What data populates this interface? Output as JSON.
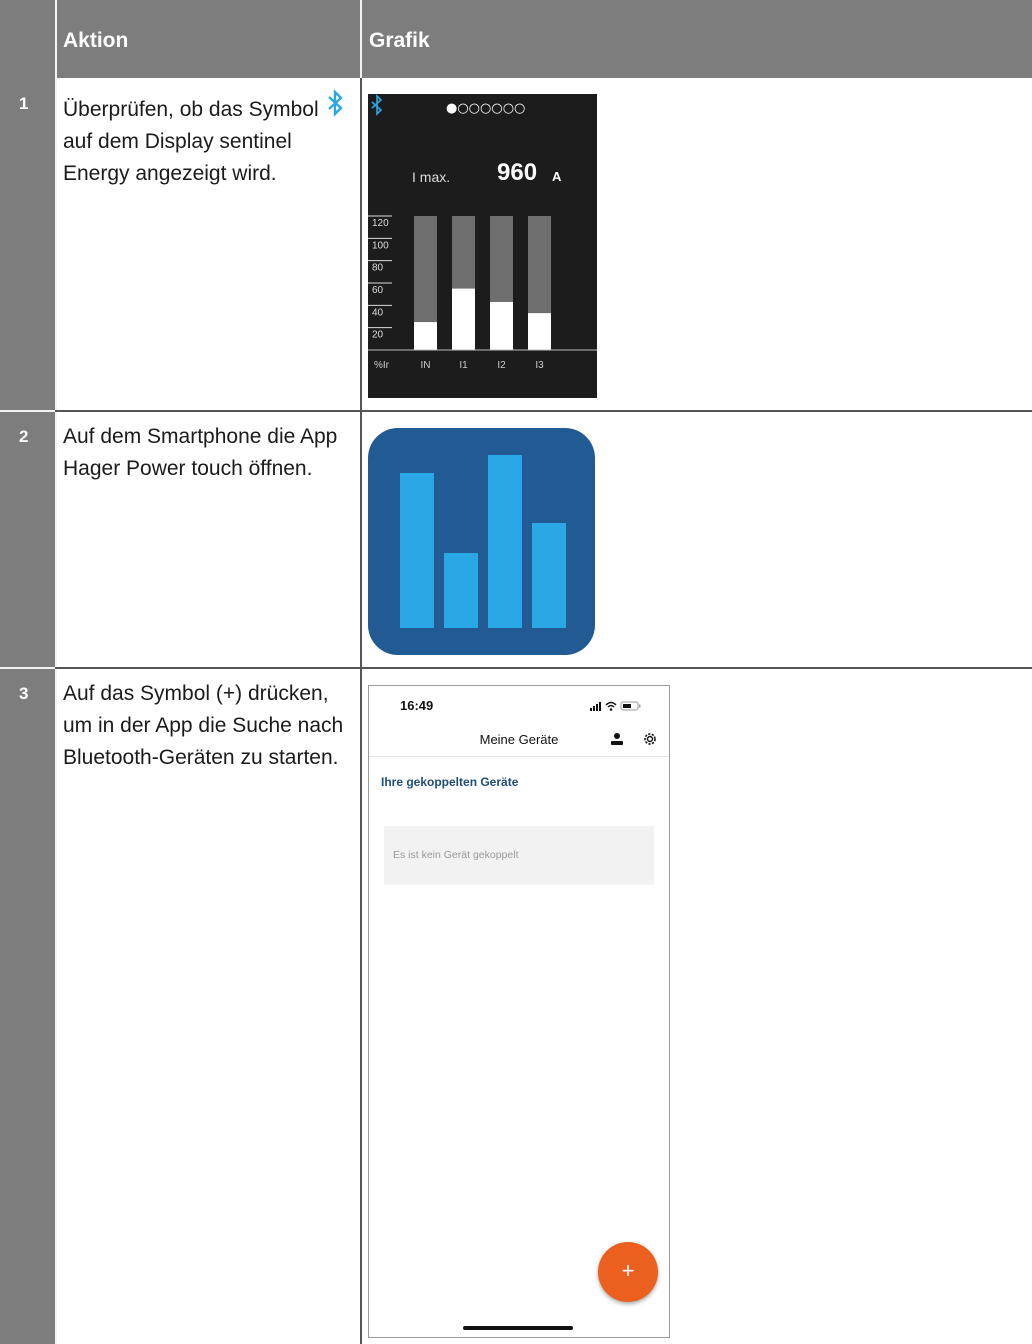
{
  "table": {
    "header": {
      "action": "Aktion",
      "graphic": "Grafik"
    },
    "rows": [
      {
        "number": "1",
        "action_before_icon": "Überprüfen, ob das Symbol ",
        "action_after_icon": " auf dem Display sentinel Energy angezeigt wird.",
        "inline_icon": "bluetooth-icon"
      },
      {
        "number": "2",
        "action": "Auf dem Smartphone die App Hager Power touch öffnen."
      },
      {
        "number": "3",
        "action": "Auf das Symbol (+) drücken, um in der App die Suche nach Bluetooth-Geräten zu starten."
      }
    ]
  },
  "sentinel_display": {
    "page_dots": "●○○○○○○",
    "label": "I max.",
    "value": "960",
    "unit": "A",
    "scale_ticks": [
      "120",
      "100",
      "80",
      "60",
      "40",
      "20"
    ],
    "categories": [
      "IN",
      "I1",
      "I2",
      "I3"
    ],
    "axis_unit": "%Ir",
    "icon": "bluetooth-icon",
    "accent_color": "#29a8e5"
  },
  "chart_data": {
    "type": "bar",
    "categories": [
      "IN",
      "I1",
      "I2",
      "I3"
    ],
    "values": [
      25,
      55,
      43,
      33
    ],
    "ylim": [
      0,
      120
    ],
    "yticks": [
      20,
      40,
      60,
      80,
      100,
      120
    ],
    "xlabel": "%Ir",
    "ylabel": ""
  },
  "app_icon": {
    "name": "app-icon",
    "background": "#225a94",
    "bar_color": "#29a8e5",
    "bar_levels": [
      0.71,
      0.35,
      0.79,
      0.49
    ]
  },
  "phone": {
    "time": "16:49",
    "title": "Meine Geräte",
    "section_title": "Ihre gekoppelten Geräte",
    "empty_message": "Es ist kein Gerät gekoppelt",
    "fab_label": "+",
    "icons": [
      "signal-icon",
      "wifi-icon",
      "battery-icon",
      "user-icon",
      "gear-icon"
    ],
    "fab_color": "#eb5f1f"
  }
}
